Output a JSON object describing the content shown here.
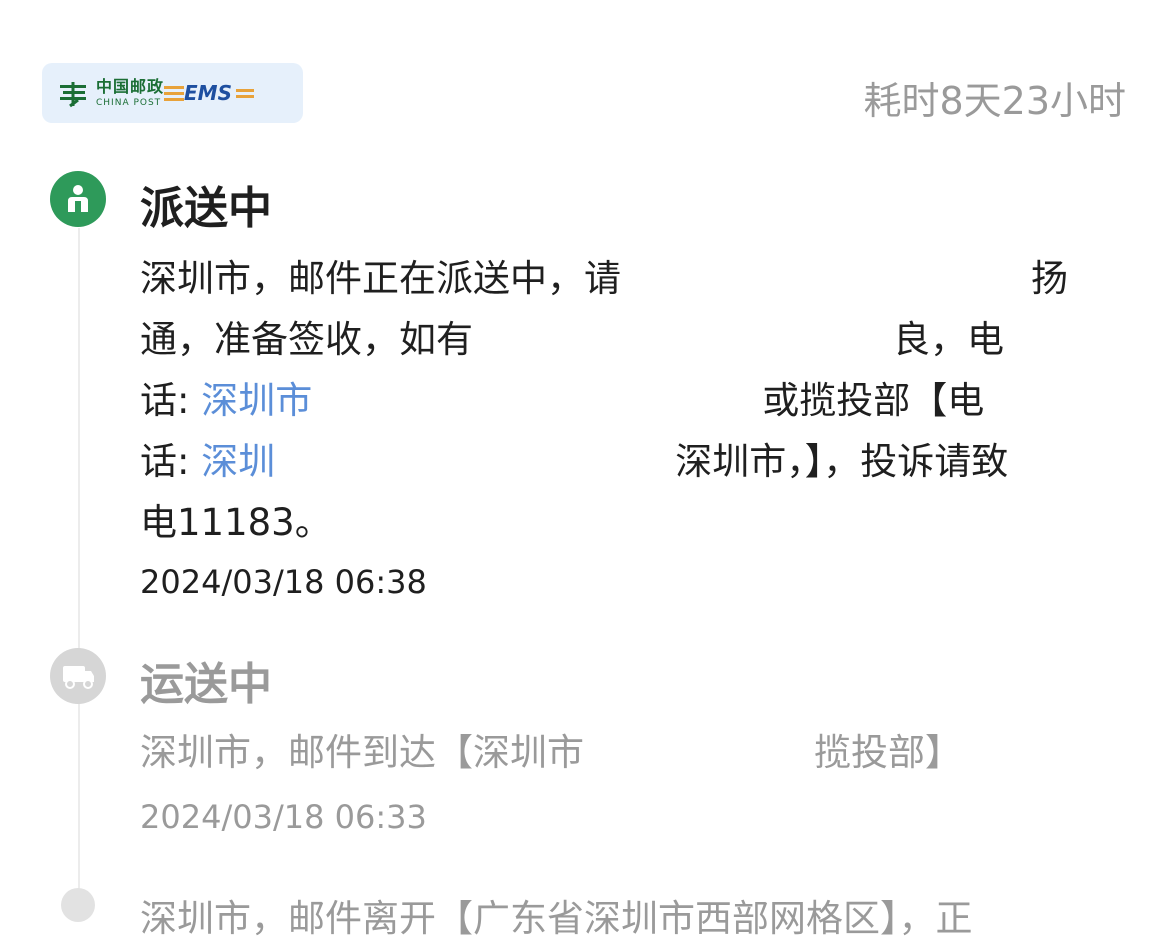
{
  "header": {
    "carrier_cn": "中国邮政",
    "carrier_en": "CHINA POST",
    "ems": "EMS",
    "duration": "耗时8天23小时"
  },
  "colors": {
    "active_green": "#2e9a5a",
    "link_blue": "#5b8ed8",
    "muted_gray": "#9a9a9a"
  },
  "steps": [
    {
      "status": "派送中",
      "icon": "courier-icon",
      "lines": [
        [
          "深圳市，邮件正在派送中，请",
          "扬"
        ],
        [
          "通，准备签收，如有",
          "良，电"
        ],
        [
          "话: ",
          "深圳市",
          "或揽投部【电"
        ],
        [
          "话: ",
          "深圳",
          "深圳市，】，投诉请致"
        ],
        [
          "电11183。"
        ]
      ],
      "time": "2024/03/18 06:38"
    },
    {
      "status": "运送中",
      "icon": "truck-icon",
      "text_a": "深圳市，邮件到达【深圳市",
      "text_b": "揽投部】",
      "time": "2024/03/18 06:33"
    }
  ],
  "next_text": "深圳市，邮件离开【广东省深圳市西部网格区】，正"
}
